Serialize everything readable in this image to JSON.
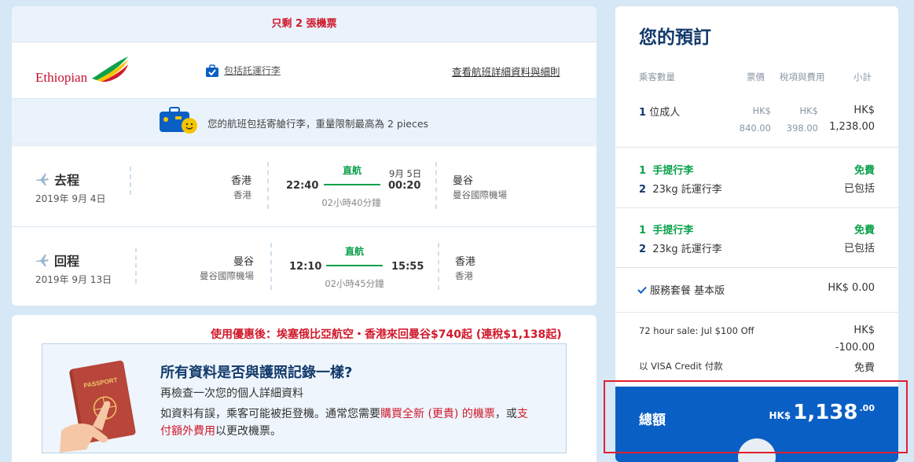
{
  "flight": {
    "alert": "只剩 2 張機票",
    "airline_name": "Ethiopian",
    "baggage_link": "包括託運行李",
    "details_link": "查看航班詳細資料與細則",
    "bag_info": "您的航班包括寄艙行李，重量限制最高為 2 pieces",
    "outbound": {
      "title": "去程",
      "date": "2019年 9月 4日",
      "from_city": "香港",
      "from_airport": "香港",
      "depart_time": "22:40",
      "direct": "直航",
      "arrive_date": "9月 5日",
      "arrive_time": "00:20",
      "duration": "02小時40分鐘",
      "to_city": "曼谷",
      "to_airport": "曼谷國際機場"
    },
    "inbound": {
      "title": "回程",
      "date": "2019年 9月 13日",
      "from_city": "曼谷",
      "from_airport": "曼谷國際機場",
      "depart_time": "12:10",
      "direct": "直航",
      "arrive_time": "15:55",
      "duration": "02小時45分鐘",
      "to_city": "香港",
      "to_airport": "香港"
    }
  },
  "promo": "使用優惠後：埃塞俄比亞航空・香港來回曼谷$740起 (連稅$1,138起)",
  "passport": {
    "title": "所有資料是否與護照記錄一樣?",
    "subtitle": "再檢查一次您的個人詳細資料",
    "body_1": "如資料有誤，乘客可能被拒登機。通常您需要",
    "body_red_1": "購買全新 (更貴) 的機票",
    "body_2": "，或",
    "body_red_2": "支付額外費用",
    "body_3": "以更改機票。"
  },
  "booking": {
    "title": "您的預訂",
    "headers": {
      "passengers": "乘客數量",
      "fare": "票價",
      "tax": "稅項與費用",
      "subtotal": "小計"
    },
    "adult": {
      "count": "1",
      "label": "位成人",
      "fare_cur": "HK$",
      "fare": "840.00",
      "tax_cur": "HK$",
      "tax": "398.00",
      "sub_cur": "HK$",
      "sub": "1,238.00"
    },
    "bag_out": {
      "cabin_count": "1",
      "cabin_label": "手提行李",
      "cabin_price": "免費",
      "checked_count": "2",
      "checked_label": "23kg 託運行李",
      "checked_status": "已包括"
    },
    "bag_in": {
      "cabin_count": "1",
      "cabin_label": "手提行李",
      "cabin_price": "免費",
      "checked_count": "2",
      "checked_label": "23kg 託運行李",
      "checked_status": "已包括"
    },
    "service": {
      "label": "服務套餐 基本版",
      "price": "HK$ 0.00"
    },
    "sale": {
      "label": "72 hour sale: Jul $100 Off",
      "cur": "HK$",
      "amount": "-100.00"
    },
    "visa": {
      "label": "以 VISA Credit 付款",
      "price": "免費"
    },
    "total": {
      "label": "總額",
      "cur": "HK$",
      "int": "1,138",
      "dec": ".00"
    }
  },
  "colors": {
    "brand_blue": "#0a5fc4",
    "green": "#0ba14b",
    "red": "#d0192b",
    "navy": "#123a6b"
  }
}
